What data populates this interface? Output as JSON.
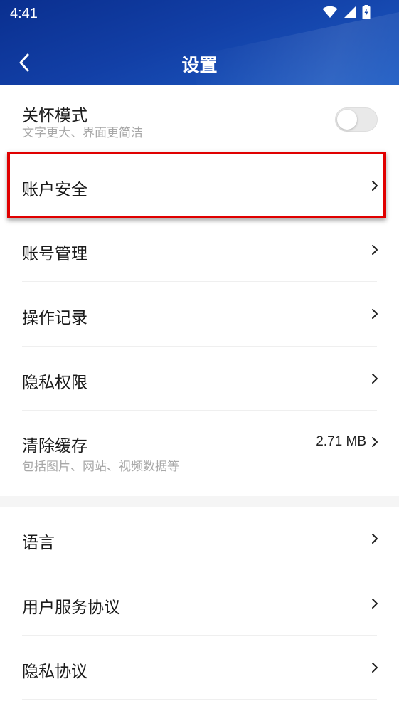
{
  "status": {
    "time": "4:41"
  },
  "nav": {
    "title": "设置"
  },
  "items": {
    "care_mode": {
      "label": "关怀模式",
      "desc": "文字更大、界面更简洁",
      "enabled": false
    },
    "account_security": {
      "label": "账户安全"
    },
    "account_management": {
      "label": "账号管理"
    },
    "operation_log": {
      "label": "操作记录"
    },
    "privacy_permissions": {
      "label": "隐私权限"
    },
    "clear_cache": {
      "label": "清除缓存",
      "desc": "包括图片、网站、视频数据等",
      "value": "2.71 MB"
    },
    "language": {
      "label": "语言"
    },
    "user_agreement": {
      "label": "用户服务协议"
    },
    "privacy_agreement": {
      "label": "隐私协议"
    }
  },
  "colors": {
    "header_blue": "#123fa6",
    "highlight_red": "#e00000"
  },
  "icons": [
    "back-icon",
    "wifi-icon",
    "signal-icon",
    "battery-icon",
    "chevron-right-icon"
  ]
}
